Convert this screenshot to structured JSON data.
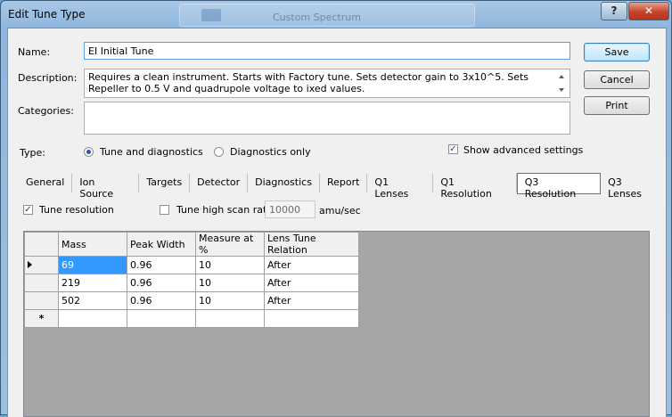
{
  "window": {
    "title": "Edit Tune Type",
    "background_title": "Custom Spectrum",
    "help_glyph": "?",
    "close_glyph": "✕"
  },
  "form": {
    "name_label": "Name:",
    "name_value": "EI Initial Tune",
    "description_label": "Description:",
    "description_value": "Requires a clean instrument. Starts with Factory tune. Sets detector gain to 3x10^5. Sets Repeller to 0.5 V and quadrupole voltage to ixed values.",
    "categories_label": "Categories:",
    "categories_value": "",
    "type_label": "Type:",
    "type_options": [
      {
        "label": "Tune and diagnostics",
        "selected": true
      },
      {
        "label": "Diagnostics only",
        "selected": false
      }
    ],
    "show_advanced_label": "Show advanced settings",
    "show_advanced_checked": true
  },
  "buttons": {
    "save": "Save",
    "cancel": "Cancel",
    "print": "Print"
  },
  "tabs": [
    {
      "label": "General",
      "active": false
    },
    {
      "label": "Ion Source",
      "active": false
    },
    {
      "label": "Targets",
      "active": false
    },
    {
      "label": "Detector",
      "active": false
    },
    {
      "label": "Diagnostics",
      "active": false
    },
    {
      "label": "Report",
      "active": false
    },
    {
      "label": "Q1 Lenses",
      "active": false
    },
    {
      "label": "Q1 Resolution",
      "active": false
    },
    {
      "label": "Q3 Resolution",
      "active": true
    },
    {
      "label": "Q3 Lenses",
      "active": false
    }
  ],
  "resolution": {
    "tune_resolution_label": "Tune resolution",
    "tune_resolution_checked": true,
    "high_scan_label": "Tune high scan rate:",
    "high_scan_checked": false,
    "high_scan_value": "10000",
    "high_scan_unit": "amu/sec"
  },
  "grid": {
    "columns": [
      "Mass",
      "Peak Width",
      "Measure at %",
      "Lens Tune Relation"
    ],
    "rows": [
      [
        "69",
        "0.96",
        "10",
        "After"
      ],
      [
        "219",
        "0.96",
        "10",
        "After"
      ],
      [
        "502",
        "0.96",
        "10",
        "After"
      ]
    ],
    "new_row_marker": "*"
  }
}
